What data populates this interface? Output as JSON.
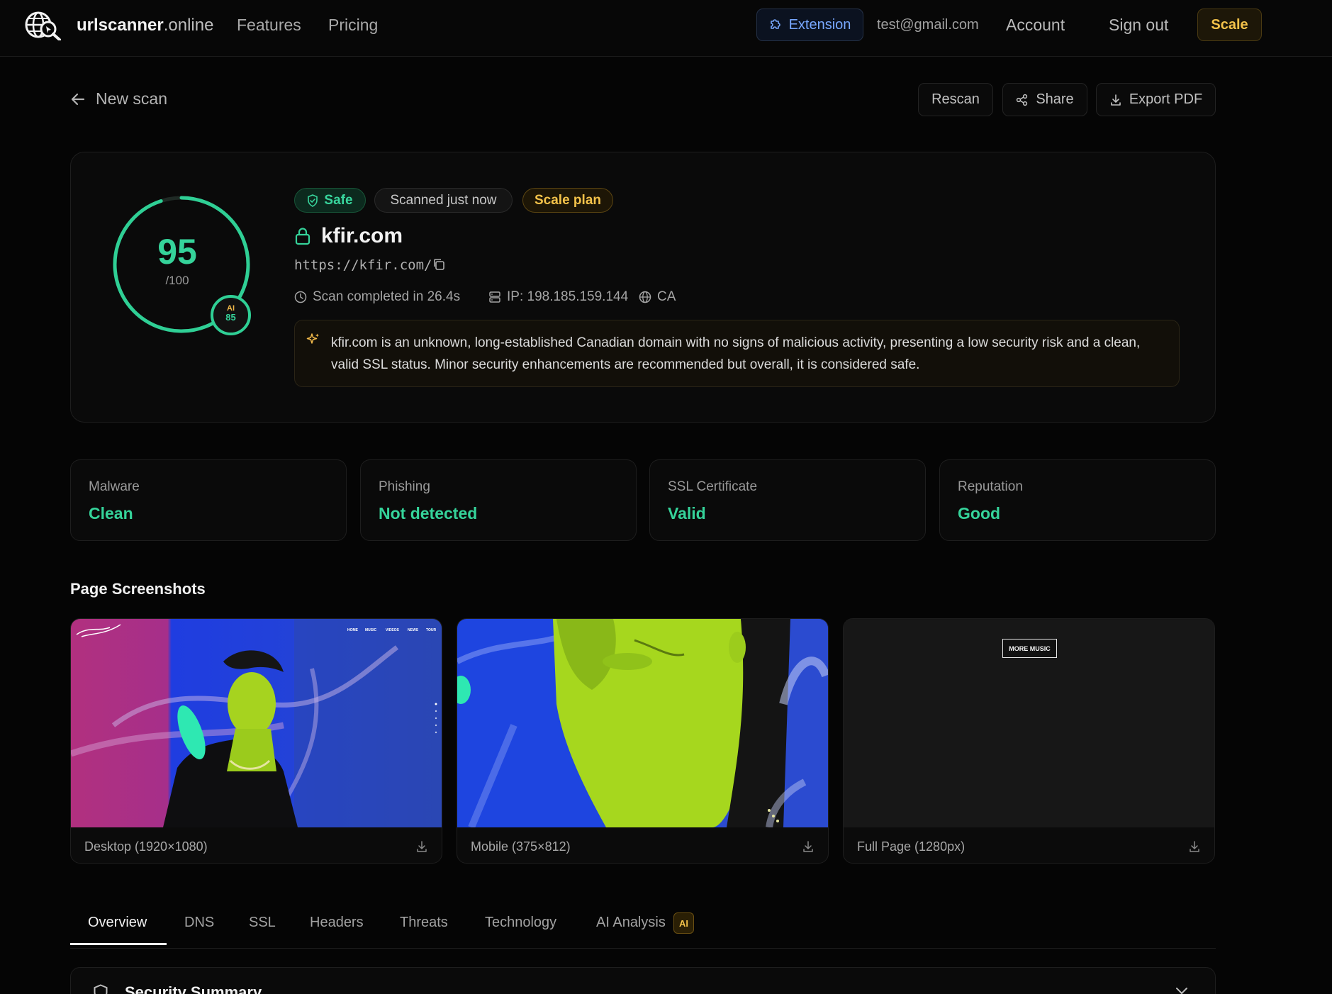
{
  "nav": {
    "brand_name": "urlscanner",
    "brand_tld": ".online",
    "links": [
      "Features",
      "Pricing"
    ],
    "extension_label": "Extension",
    "email": "test@gmail.com",
    "account_label": "Account",
    "signout_label": "Sign out",
    "plan_button": "Scale"
  },
  "toolbar": {
    "back_label": "New scan",
    "rescan_label": "Rescan",
    "share_label": "Share",
    "export_label": "Export PDF"
  },
  "summary": {
    "score": "95",
    "score_max": "/100",
    "score_fraction": 0.95,
    "ai_label": "AI",
    "ai_score": "85",
    "badges": {
      "safe": "Safe",
      "scanned": "Scanned just now",
      "plan": "Scale plan"
    },
    "domain": "kfir.com",
    "url": "https://kfir.com/",
    "scan_time": "Scan completed in 26.4s",
    "ip": "IP: 198.185.159.144",
    "country": "CA",
    "ai_summary": "kfir.com is an unknown, long-established Canadian domain with no signs of malicious activity, presenting a low security risk and a clean, valid SSL status. Minor security enhancements are recommended but overall, it is considered safe."
  },
  "stats": [
    {
      "label": "Malware",
      "value": "Clean"
    },
    {
      "label": "Phishing",
      "value": "Not detected"
    },
    {
      "label": "SSL Certificate",
      "value": "Valid"
    },
    {
      "label": "Reputation",
      "value": "Good"
    }
  ],
  "screenshots": {
    "title": "Page Screenshots",
    "items": [
      {
        "caption": "Desktop (1920×1080)"
      },
      {
        "caption": "Mobile (375×812)"
      },
      {
        "caption": "Full Page (1280px)",
        "overlay_text": "MORE MUSIC"
      }
    ],
    "desktop_nav": [
      "HOME",
      "MUSIC",
      "VIDEOS",
      "NEWS",
      "TOUR"
    ]
  },
  "tabs": [
    "Overview",
    "DNS",
    "SSL",
    "Headers",
    "Threats",
    "Technology",
    "AI Analysis"
  ],
  "tabs_ai_tag": "AI",
  "active_tab": "Overview",
  "bottom_section": {
    "title": "Security Summary"
  },
  "colors": {
    "background": "#050505",
    "accent_green": "#35d39a",
    "accent_gold": "#f3c24a",
    "extension_blue": "#78a8ff"
  }
}
